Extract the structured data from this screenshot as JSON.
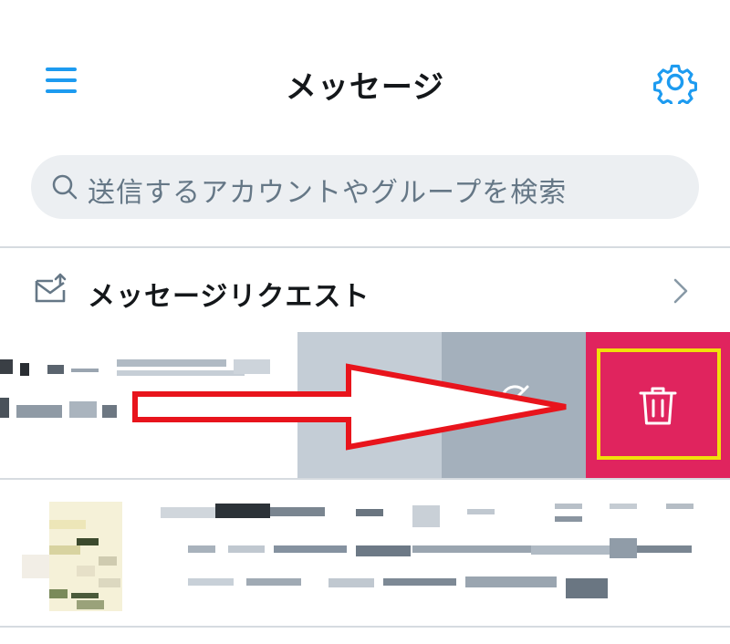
{
  "header": {
    "title": "メッセージ"
  },
  "search": {
    "placeholder": "送信するアカウントやグループを検索"
  },
  "request_row": {
    "label": "メッセージリクエスト"
  },
  "colors": {
    "accent": "#1d9bf0",
    "delete": "#e0245e",
    "highlight": "#f1e00a",
    "arrow": "#e8141c"
  },
  "icons": {
    "menu": "hamburger-icon",
    "settings": "gear-icon",
    "search": "search-icon",
    "request": "mail-request-icon",
    "chevron": "chevron-right-icon",
    "snooze": "snooze-icon",
    "delete": "trash-icon"
  }
}
